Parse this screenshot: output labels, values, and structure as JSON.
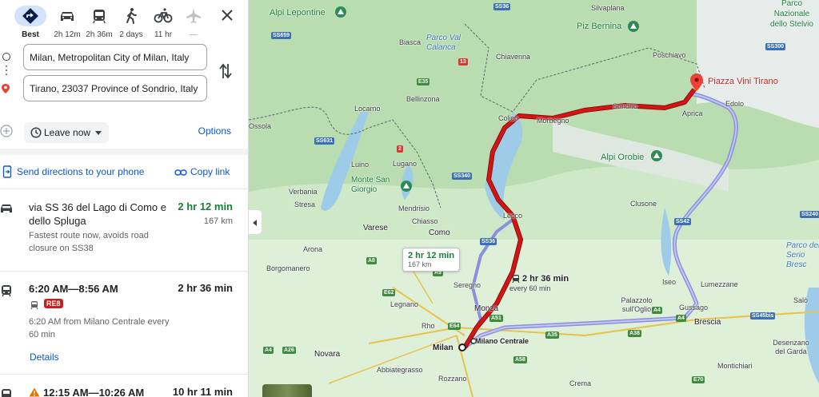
{
  "travel_modes": [
    {
      "label": "Best",
      "icon": "directions-diamond-icon",
      "selected": true
    },
    {
      "label": "2h 12m",
      "icon": "car-icon"
    },
    {
      "label": "2h 36m",
      "icon": "transit-icon"
    },
    {
      "label": "2 days",
      "icon": "walking-icon"
    },
    {
      "label": "11 hr",
      "icon": "bicycle-icon"
    },
    {
      "label": "—",
      "icon": "flight-icon",
      "disabled": true
    }
  ],
  "origin": "Milan, Metropolitan City of Milan, Italy",
  "destination": "Tirano, 23037 Province of Sondrio, Italy",
  "depart": {
    "label": "Leave now",
    "options_label": "Options"
  },
  "share": {
    "send_label": "Send directions to your phone",
    "copy_label": "Copy link"
  },
  "routes": [
    {
      "icon": "car-icon",
      "name": "via SS 36 del Lago di Como e dello Spluga",
      "time": "2 hr 12 min",
      "distance": "167 km",
      "description": "Fastest route now, avoids road closure on SS38"
    },
    {
      "icon": "train-icon",
      "name": "6:20 AM—8:56 AM",
      "time": "2 hr 36 min",
      "badge": "RE8",
      "description": "6:20 AM from Milano Centrale every 60 min",
      "details_label": "Details"
    },
    {
      "icon": "train-icon",
      "name": "12:15 AM—10:26 AM",
      "time": "10 hr 11 min",
      "warning": true
    }
  ],
  "map": {
    "callout_time": "2 hr 12 min",
    "callout_distance": "167 km",
    "alt_time": "2 hr 36 min",
    "alt_sub": "every 60 min",
    "destination_label": "Piazza Vini Tirano",
    "origin_label": "Milan",
    "station_label": "Milano Centrale",
    "places": [
      {
        "name": "Alpi Lepontine",
        "kind": "park"
      },
      {
        "name": "Piz Bernina",
        "kind": "park"
      },
      {
        "name": "Parco Nazionale dello Stelvio",
        "kind": "park"
      },
      {
        "name": "Alpi Orobie",
        "kind": "park"
      },
      {
        "name": "Monte San Giorgio",
        "kind": "park"
      },
      {
        "name": "Parco Val Calanca",
        "kind": "water"
      },
      {
        "name": "Parco del Serio Bresc",
        "kind": "water"
      },
      {
        "name": "Silvaplana",
        "kind": "town"
      },
      {
        "name": "Poschiavo",
        "kind": "town"
      },
      {
        "name": "Biasca",
        "kind": "town"
      },
      {
        "name": "Chiavenna",
        "kind": "town"
      },
      {
        "name": "Bellinzona",
        "kind": "town"
      },
      {
        "name": "Locarno",
        "kind": "town"
      },
      {
        "name": "Lugano",
        "kind": "town"
      },
      {
        "name": "Luino",
        "kind": "town"
      },
      {
        "name": "Mendrisio",
        "kind": "town"
      },
      {
        "name": "Chiasso",
        "kind": "town"
      },
      {
        "name": "Verbania",
        "kind": "town"
      },
      {
        "name": "Stresa",
        "kind": "town"
      },
      {
        "name": "Arona",
        "kind": "town"
      },
      {
        "name": "Borgomanero",
        "kind": "town"
      },
      {
        "name": "Varese",
        "kind": "city"
      },
      {
        "name": "Como",
        "kind": "city"
      },
      {
        "name": "Lecco",
        "kind": "town"
      },
      {
        "name": "Colico",
        "kind": "town"
      },
      {
        "name": "Morbegno",
        "kind": "town"
      },
      {
        "name": "Sondrio",
        "kind": "town"
      },
      {
        "name": "Aprica",
        "kind": "town"
      },
      {
        "name": "Edolo",
        "kind": "town"
      },
      {
        "name": "Clusone",
        "kind": "town"
      },
      {
        "name": "Iseo",
        "kind": "town"
      },
      {
        "name": "Lumezzane",
        "kind": "town"
      },
      {
        "name": "Palazzolo sull'Oglio",
        "kind": "town"
      },
      {
        "name": "Gussago",
        "kind": "town"
      },
      {
        "name": "Brescia",
        "kind": "city"
      },
      {
        "name": "Seregno",
        "kind": "town"
      },
      {
        "name": "Monza",
        "kind": "city"
      },
      {
        "name": "Legnano",
        "kind": "town"
      },
      {
        "name": "Rho",
        "kind": "town"
      },
      {
        "name": "Novara",
        "kind": "city"
      },
      {
        "name": "Abbiategrasso",
        "kind": "town"
      },
      {
        "name": "Rozzano",
        "kind": "town"
      },
      {
        "name": "Crema",
        "kind": "town"
      },
      {
        "name": "Desenzano del Garda",
        "kind": "town"
      },
      {
        "name": "Montichiari",
        "kind": "town"
      },
      {
        "name": "Salò",
        "kind": "town"
      },
      {
        "name": "Ossola",
        "kind": "town"
      }
    ],
    "roads": [
      "SS36",
      "SS659",
      "E35",
      "13",
      "SS631",
      "2",
      "SS340",
      "SS36",
      "A8",
      "E62",
      "A9",
      "E64",
      "A51",
      "A4",
      "A26",
      "A35",
      "A58",
      "E70",
      "SS300",
      "SS42",
      "SS240",
      "A4",
      "A4",
      "SS45bis",
      "A38"
    ]
  },
  "colors": {
    "main_route": "#d31515",
    "alt_route": "#8a8fe0",
    "link": "#0b57d0",
    "fast": "#188038"
  }
}
